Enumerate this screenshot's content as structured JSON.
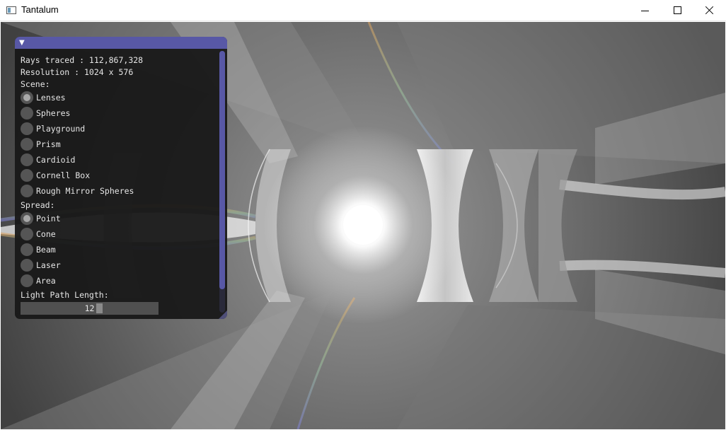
{
  "window": {
    "title": "Tantalum"
  },
  "panel": {
    "stats": {
      "rays_traced": "Rays traced : 112,867,328",
      "resolution": "Resolution : 1024 x 576"
    },
    "scene": {
      "label": "Scene:",
      "options": [
        "Lenses",
        "Spheres",
        "Playground",
        "Prism",
        "Cardioid",
        "Cornell Box",
        "Rough Mirror Spheres"
      ],
      "selected": "Lenses"
    },
    "spread": {
      "label": "Spread:",
      "options": [
        "Point",
        "Cone",
        "Beam",
        "Laser",
        "Area"
      ],
      "selected": "Point"
    },
    "light_path_length": {
      "label": "Light Path Length:",
      "value": "12"
    }
  }
}
